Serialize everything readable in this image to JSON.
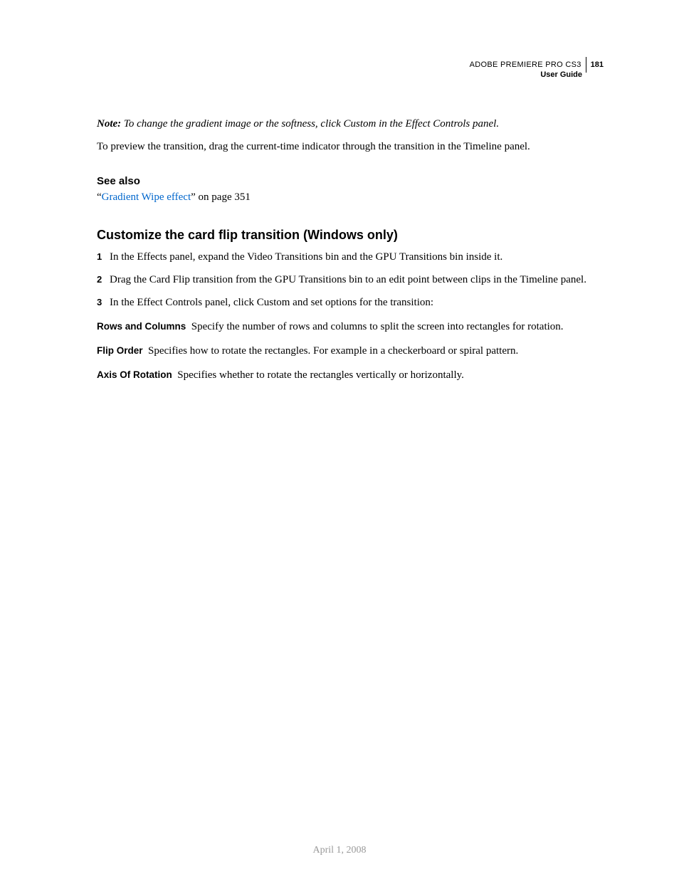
{
  "header": {
    "product": "ADOBE PREMIERE PRO CS3",
    "page_number": "181",
    "guide": "User Guide"
  },
  "note": {
    "label": "Note:",
    "text": "To change the gradient image or the softness, click Custom in the Effect Controls panel."
  },
  "preview_text": "To preview the transition, drag the current-time indicator through the transition in the Timeline panel.",
  "see_also": {
    "heading": "See also",
    "quote_open": "“",
    "link_text": "Gradient Wipe effect",
    "quote_close": "” on page 351"
  },
  "section": {
    "heading": "Customize the card flip transition (Windows only)",
    "steps": [
      {
        "num": "1",
        "text": "In the Effects panel, expand the Video Transitions bin and the GPU Transitions bin inside it."
      },
      {
        "num": "2",
        "text": "Drag the Card Flip transition from the GPU Transitions bin to an edit point between clips in the Timeline panel."
      },
      {
        "num": "3",
        "text": "In the Effect Controls panel, click Custom and set options for the transition:"
      }
    ],
    "defs": [
      {
        "term": "Rows and Columns",
        "desc": "Specify the number of rows and columns to split the screen into rectangles for rotation."
      },
      {
        "term": "Flip Order",
        "desc": "Specifies how to rotate the rectangles. For example in a checkerboard or spiral pattern."
      },
      {
        "term": "Axis Of Rotation",
        "desc": "Specifies whether to rotate the rectangles vertically or horizontally."
      }
    ]
  },
  "footer_date": "April 1, 2008"
}
